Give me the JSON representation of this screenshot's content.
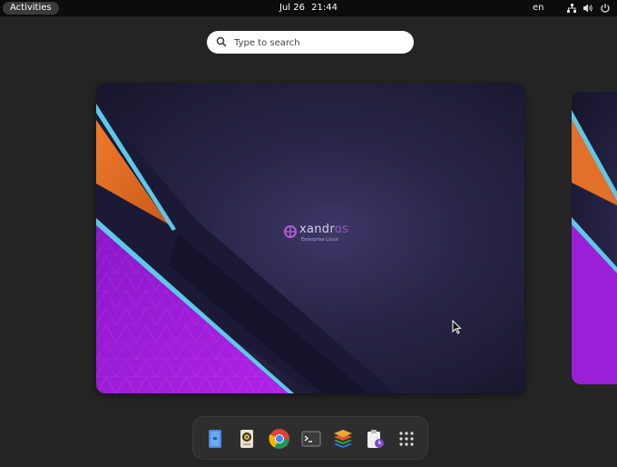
{
  "topbar": {
    "activities_label": "Activities",
    "date": "Jul 26",
    "time": "21:44",
    "language": "en",
    "tray_icons": [
      "network-icon",
      "volume-icon",
      "power-icon"
    ]
  },
  "search": {
    "placeholder": "Type to search",
    "value": ""
  },
  "workspace": {
    "brand_prefix": "xandr",
    "brand_suffix": "os",
    "brand_subtitle": "Enterprise Linux"
  },
  "dock": {
    "items": [
      {
        "icon": "files-icon"
      },
      {
        "icon": "speaker-app-icon"
      },
      {
        "icon": "chrome-icon"
      },
      {
        "icon": "terminal-icon"
      },
      {
        "icon": "layers-app-icon"
      },
      {
        "icon": "clipboard-clock-icon"
      },
      {
        "icon": "app-grid-icon"
      }
    ]
  },
  "colors": {
    "topbar_bg": "#0c0c0c",
    "overview_bg": "#242424",
    "accent_purple": "#9b1fd6",
    "accent_orange": "#e0702a",
    "accent_cyan": "#5ec8e8"
  }
}
